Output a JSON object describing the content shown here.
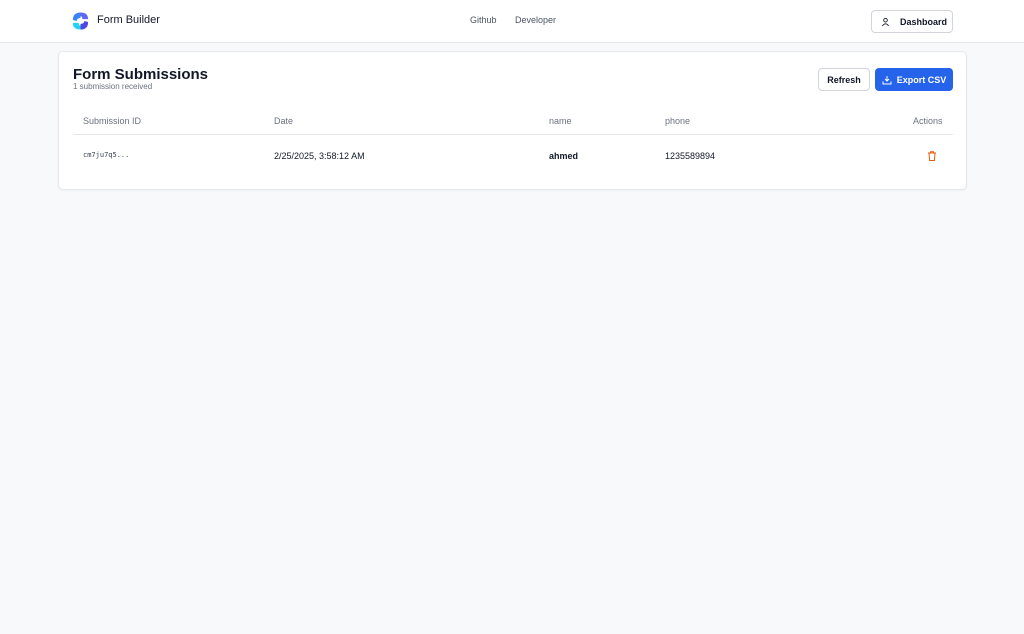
{
  "header": {
    "brand": "Form Builder",
    "nav": [
      "Github",
      "Developer"
    ],
    "dashboard_label": "Dashboard"
  },
  "card": {
    "title": "Form Submissions",
    "subtitle": "1 submission received",
    "refresh_label": "Refresh",
    "export_label": "Export CSV"
  },
  "table": {
    "columns": [
      "Submission ID",
      "Date",
      "name",
      "phone",
      "Actions"
    ],
    "rows": [
      {
        "id": "cm7ju7q5...",
        "date": "2/25/2025, 3:58:12 AM",
        "name": "ahmed",
        "phone": "1235589894"
      }
    ]
  },
  "colors": {
    "accent": "#2563eb",
    "danger": "#ea580c"
  }
}
